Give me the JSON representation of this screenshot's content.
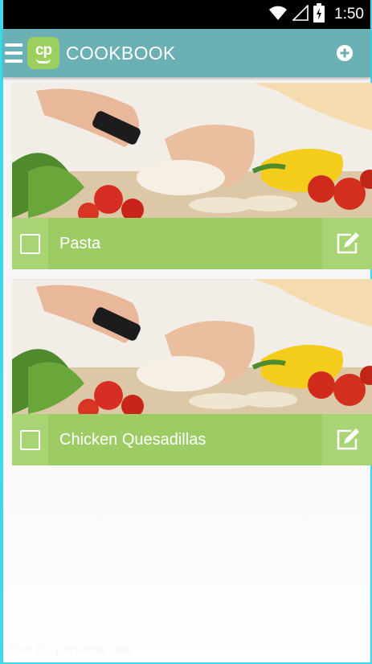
{
  "status_bar": {
    "time": "1:50",
    "icons": [
      "wifi-icon",
      "signal-icon",
      "battery-icon"
    ]
  },
  "app_bar": {
    "logo_text": "cp",
    "title": "COOKBOOK",
    "menu_icon": "menu-icon",
    "add_icon": "add-circle-icon"
  },
  "recipes": [
    {
      "name": "Pasta",
      "checked": false,
      "image": "cooking-photo"
    },
    {
      "name": "Chicken Quesadillas",
      "checked": false,
      "image": "cooking-photo"
    }
  ],
  "watermark": "free for personal use",
  "colors": {
    "app_bar": "#6ab0b5",
    "card_footer": "#9dcb64",
    "accent_green": "#a9d473",
    "frame_border": "#3fd8e8"
  }
}
